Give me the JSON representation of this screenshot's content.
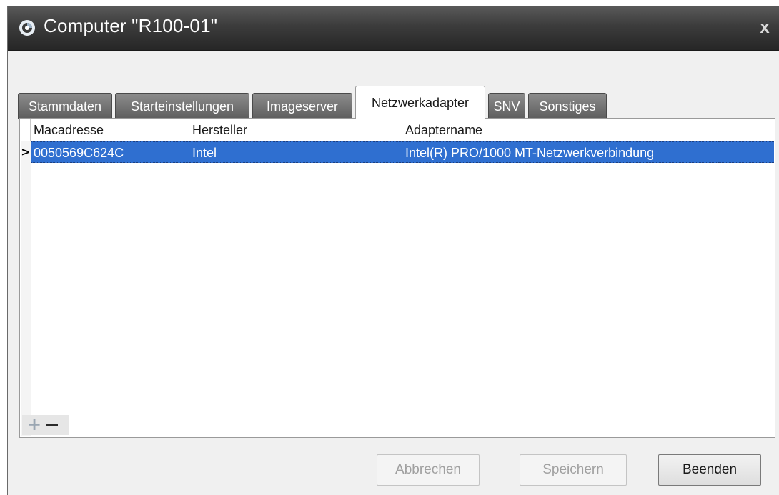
{
  "window": {
    "title": "Computer \"R100-01\"",
    "close_glyph": "x"
  },
  "tabs": [
    {
      "label": "Stammdaten"
    },
    {
      "label": "Starteinstellungen"
    },
    {
      "label": "Imageserver"
    },
    {
      "label": "Netzwerkadapter",
      "active": true
    },
    {
      "label": "SNV"
    },
    {
      "label": "Sonstiges"
    }
  ],
  "grid": {
    "columns": [
      "Macadresse",
      "Hersteller",
      "Adaptername"
    ],
    "rows": [
      {
        "indicator": ">",
        "cells": [
          "0050569C624C",
          "Intel",
          "Intel(R) PRO/1000 MT-Netzwerkverbindung"
        ],
        "selected": true
      }
    ],
    "add_glyph": "+",
    "remove_glyph": "−"
  },
  "buttons": {
    "cancel": "Abbrechen",
    "save": "Speichern",
    "close": "Beenden"
  },
  "colors": {
    "selection": "#2f6fd0",
    "titlebar": "#3c3c3c"
  },
  "icons": {
    "app": "app-logo-icon",
    "close": "close-icon",
    "add": "add-icon",
    "remove": "remove-icon",
    "row_indicator": "row-indicator-icon"
  }
}
